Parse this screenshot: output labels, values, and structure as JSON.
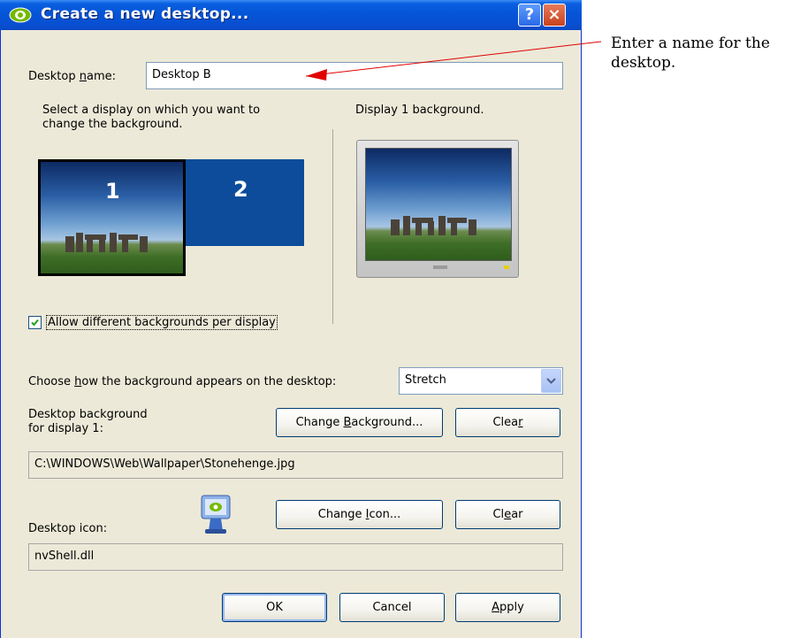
{
  "window": {
    "title": "Create a new desktop...",
    "help_label": "?",
    "close_label": "×"
  },
  "desktop_name": {
    "label_pre": "Desktop ",
    "label_mnemonic": "n",
    "label_post": "ame:",
    "value": "Desktop B"
  },
  "display_select": {
    "instruction_line1": "Select a display on which you want to",
    "instruction_line2": "change the background.",
    "display1_label": "1",
    "display2_label": "2"
  },
  "preview": {
    "label": "Display 1 background."
  },
  "allow_different": {
    "label": "Allow different backgrounds per display",
    "checked": true
  },
  "position": {
    "label_pre": "Choose ",
    "label_mnemonic": "h",
    "label_post": "ow the background appears on the desktop:",
    "selected": "Stretch"
  },
  "background": {
    "label_line1": "Desktop background",
    "label_line2": "for display 1:",
    "change_pre": "Change ",
    "change_mnemonic": "B",
    "change_post": "ackground...",
    "clear_pre": "Clea",
    "clear_mnemonic": "r",
    "clear_post": "",
    "path": "C:\\WINDOWS\\Web\\Wallpaper\\Stonehenge.jpg"
  },
  "icon": {
    "label": "Desktop icon:",
    "change_pre": "Change ",
    "change_mnemonic": "I",
    "change_post": "con...",
    "clear_pre": "Cl",
    "clear_mnemonic": "e",
    "clear_post": "ar",
    "file": "nvShell.dll"
  },
  "footer": {
    "ok": "OK",
    "cancel": "Cancel",
    "apply_mnemonic": "A",
    "apply_post": "pply"
  },
  "annotation": {
    "line1": "Enter a name for the",
    "line2": "desktop."
  },
  "colors": {
    "title_bar": "#0554d7",
    "dialog_bg": "#ece9d8",
    "display2_fill": "#0c4c9a",
    "arrow": "#e00000"
  },
  "icons": [
    "nvidia-eye-icon",
    "help-icon",
    "close-icon",
    "checkbox-check-icon",
    "dropdown-chevron-icon",
    "desktop-monitor-icon"
  ]
}
